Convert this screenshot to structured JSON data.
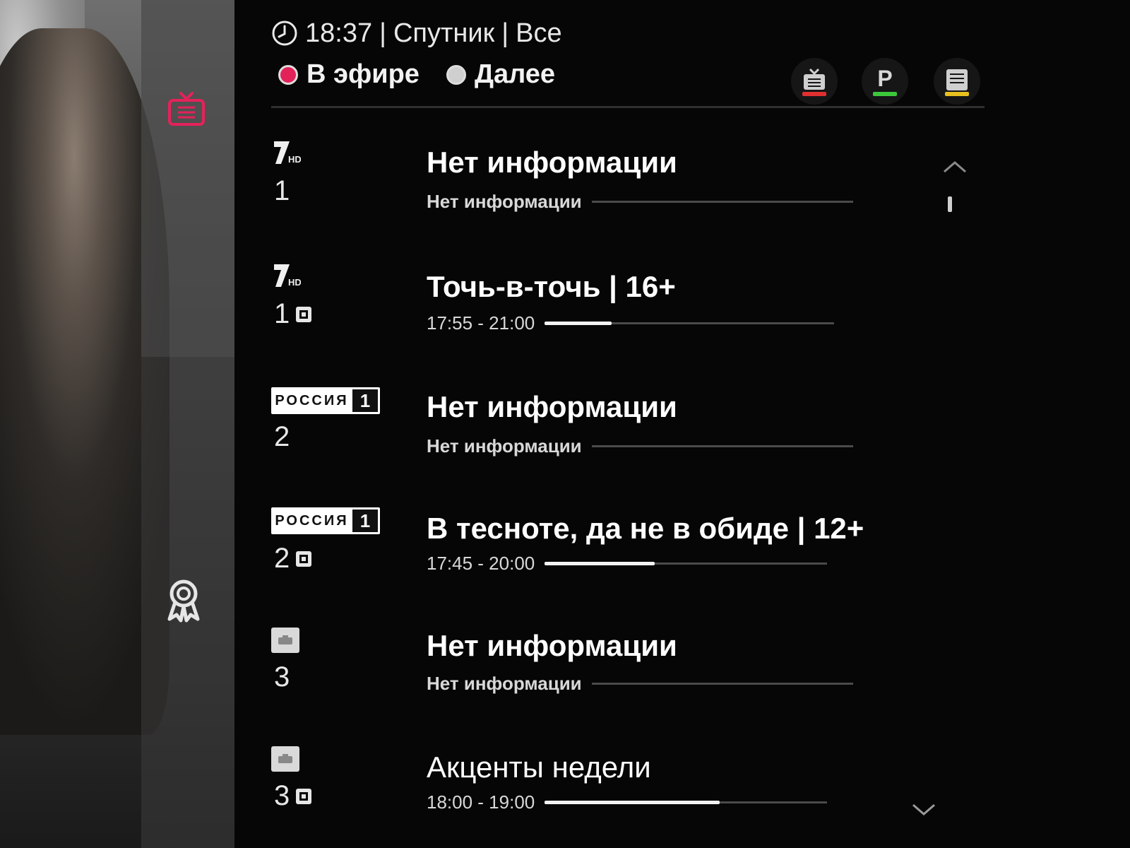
{
  "header": {
    "time": "18:37",
    "separator": "|",
    "source": "Спутник",
    "filter": "Все"
  },
  "tabs": [
    {
      "label": "В эфире",
      "state": "active"
    },
    {
      "label": "Далее",
      "state": "inactive"
    }
  ],
  "actions": [
    {
      "icon": "tv-guide-icon",
      "color_bar": "#e03030"
    },
    {
      "icon": "p-letter-icon",
      "letter": "P",
      "color_bar": "#3cc83c"
    },
    {
      "icon": "list-icon",
      "color_bar": "#e8c020"
    }
  ],
  "sidebar": {
    "items": [
      {
        "icon": "tv-icon",
        "active": true,
        "color": "#e4225a"
      },
      {
        "icon": "award-icon",
        "active": false,
        "color": "#e0e0e0"
      }
    ]
  },
  "channels": [
    {
      "logo": "1HD",
      "number": "1",
      "encrypted": false,
      "title": "Нет информации",
      "subtitle": "Нет информации",
      "time": "",
      "progress": null
    },
    {
      "logo": "1HD",
      "number": "1",
      "encrypted": true,
      "title": "Точь-в-точь | 16+",
      "subtitle": "",
      "time": "17:55 - 21:00",
      "progress": 0.23
    },
    {
      "logo": "РОССИЯ 1",
      "logo_word": "РОССИЯ",
      "logo_num": "1",
      "number": "2",
      "encrypted": false,
      "title": "Нет информации",
      "subtitle": "Нет информации",
      "time": "",
      "progress": null
    },
    {
      "logo": "РОССИЯ 1",
      "logo_word": "РОССИЯ",
      "logo_num": "1",
      "number": "2",
      "encrypted": true,
      "title": "В тесноте, да не в обиде | 12+",
      "subtitle": "",
      "time": "17:45 - 20:00",
      "progress": 0.39
    },
    {
      "logo": "generic",
      "number": "3",
      "encrypted": false,
      "title": "Нет информации",
      "subtitle": "Нет информации",
      "time": "",
      "progress": null
    },
    {
      "logo": "generic",
      "number": "3",
      "encrypted": true,
      "title": "Акценты недели",
      "subtitle": "",
      "time": "18:00 - 19:00",
      "progress": 0.62
    }
  ],
  "colors": {
    "accent": "#e4225a",
    "text": "#ffffff",
    "muted": "#d8d8d8",
    "track": "#4a4a4a"
  }
}
